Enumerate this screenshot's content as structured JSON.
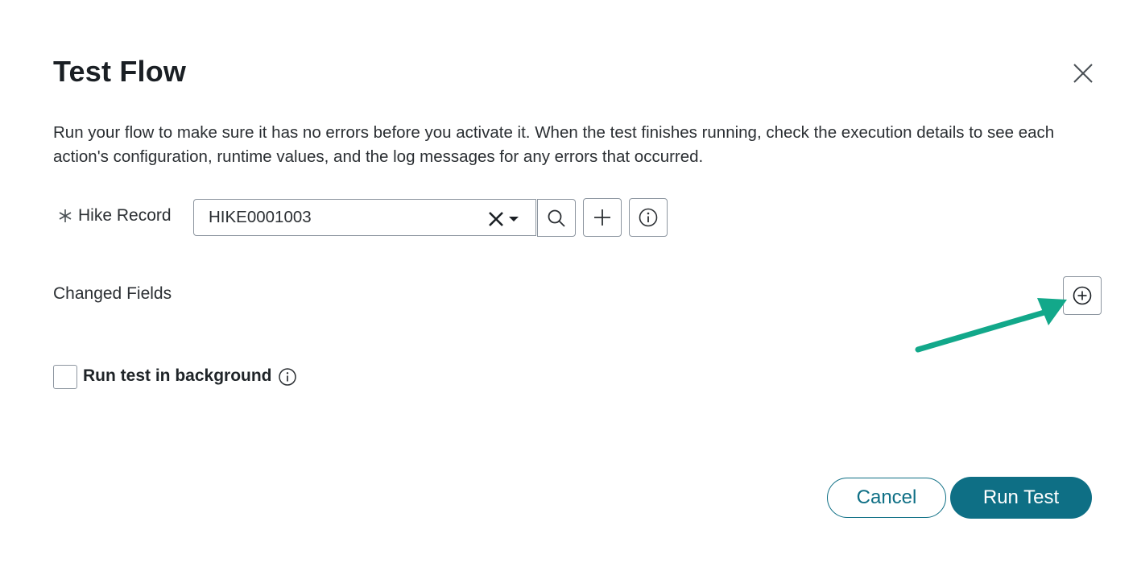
{
  "dialog": {
    "title": "Test Flow",
    "description": "Run your flow to make sure it has no errors before you activate it. When the test finishes running, check the execution details to see each action's configuration, runtime values, and the log messages for any errors that occurred."
  },
  "trigger_field": {
    "label": "Hike Record",
    "value": "HIKE0001003",
    "required": true
  },
  "changed_fields": {
    "label": "Changed Fields"
  },
  "background_option": {
    "label": "Run test in background",
    "checked": false
  },
  "footer": {
    "cancel_label": "Cancel",
    "run_label": "Run Test"
  },
  "colors": {
    "primary": "#0e6f85",
    "annotation_arrow": "#12a88a"
  },
  "icons": {
    "close": "close-icon",
    "required": "asterisk-icon",
    "clear": "clear-icon",
    "dropdown": "caret-down-icon",
    "search": "search-icon",
    "add": "plus-icon",
    "info": "info-icon",
    "add_field": "plus-circle-icon"
  }
}
